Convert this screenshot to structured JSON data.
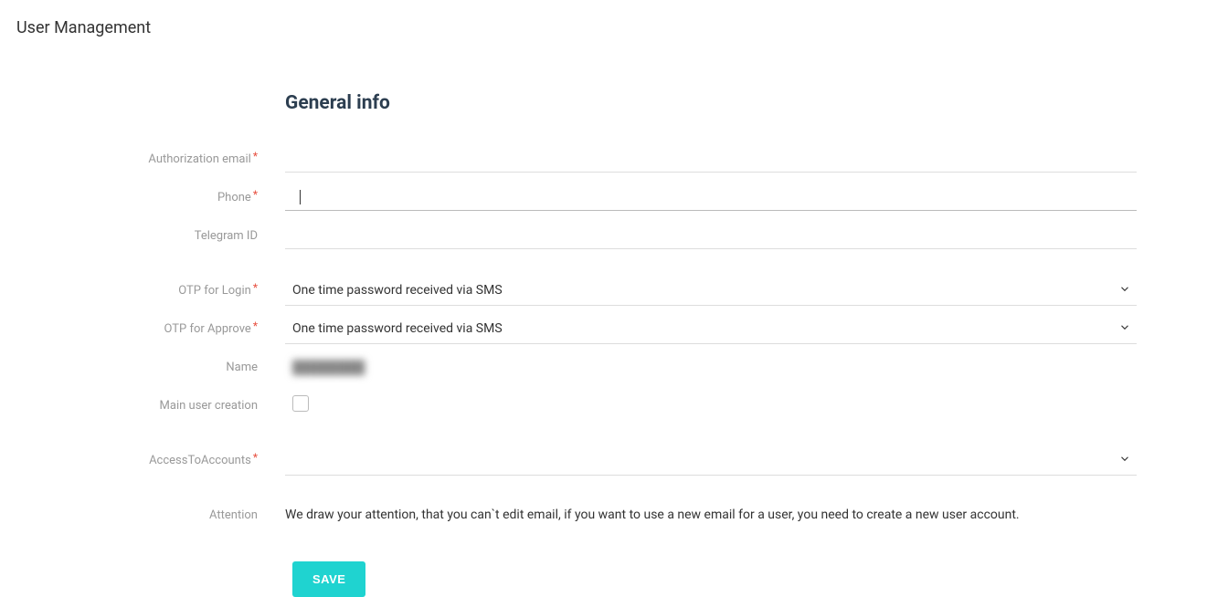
{
  "page": {
    "title": "User Management"
  },
  "section": {
    "title": "General info"
  },
  "fields": {
    "auth_email": {
      "label": "Authorization email",
      "value": "",
      "required": true
    },
    "phone": {
      "label": "Phone",
      "value": "",
      "required": true
    },
    "telegram": {
      "label": "Telegram ID",
      "value": "",
      "required": false
    },
    "otp_login": {
      "label": "OTP for Login",
      "value": "One time password received via SMS",
      "required": true
    },
    "otp_approve": {
      "label": "OTP for Approve",
      "value": "One time password received via SMS",
      "required": true
    },
    "name": {
      "label": "Name",
      "value": "████████",
      "required": false
    },
    "main_user": {
      "label": "Main user creation",
      "checked": false,
      "required": false
    },
    "access_accounts": {
      "label": "AccessToAccounts",
      "value": "",
      "required": true
    },
    "attention": {
      "label": "Attention",
      "text": "We draw your attention, that you can`t edit email, if you want to use a new email for a user, you need to create a new user account."
    }
  },
  "buttons": {
    "save": "Save"
  }
}
